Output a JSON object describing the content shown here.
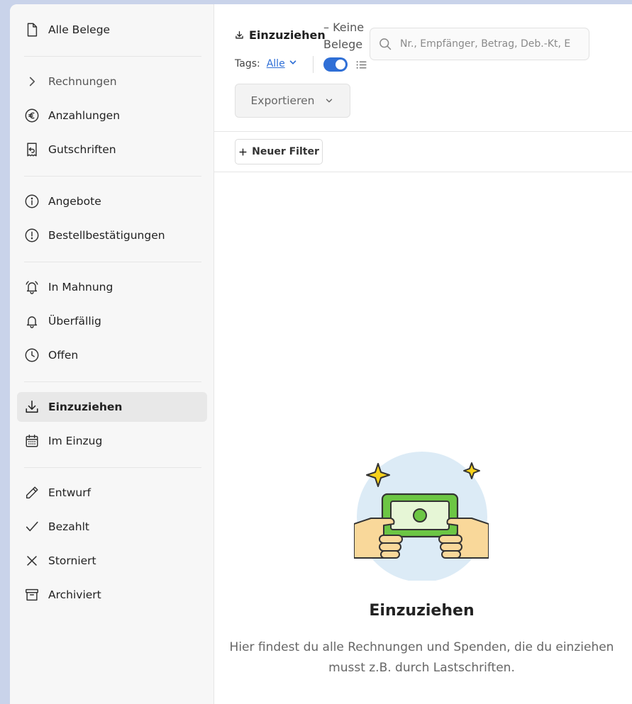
{
  "sidebar": {
    "items": [
      {
        "label": "Alle Belege",
        "icon": "document-icon"
      },
      {
        "label": "Rechnungen",
        "icon": "chevron-right-icon"
      },
      {
        "label": "Anzahlungen",
        "icon": "euro-icon"
      },
      {
        "label": "Gutschriften",
        "icon": "receipt-return-icon"
      },
      {
        "label": "Angebote",
        "icon": "info-icon"
      },
      {
        "label": "Bestellbestätigungen",
        "icon": "exclamation-icon"
      },
      {
        "label": "In Mahnung",
        "icon": "alarm-bell-icon"
      },
      {
        "label": "Überfällig",
        "icon": "bell-icon"
      },
      {
        "label": "Offen",
        "icon": "clock-icon"
      },
      {
        "label": "Einzuziehen",
        "icon": "download-icon",
        "active": true
      },
      {
        "label": "Im Einzug",
        "icon": "calendar-icon"
      },
      {
        "label": "Entwurf",
        "icon": "pencil-icon"
      },
      {
        "label": "Bezahlt",
        "icon": "check-icon"
      },
      {
        "label": "Storniert",
        "icon": "x-icon"
      },
      {
        "label": "Archiviert",
        "icon": "archive-icon"
      }
    ]
  },
  "toolbar": {
    "title": "Einzuziehen",
    "count": "– Keine Belege",
    "search_placeholder": "Nr., Empfänger, Betrag, Deb.-Kt, E",
    "tags_label": "Tags:",
    "tags_value": "Alle",
    "toggle_on": true,
    "export_label": "Exportieren",
    "new_filter_label": "Neuer Filter"
  },
  "empty_state": {
    "title": "Einzuziehen",
    "description": "Hier findest du alle Rechnungen und Spenden, die du einziehen musst z.B. durch Lastschriften."
  },
  "colors": {
    "accent": "#2f6fd6",
    "sidebar_bg": "#f7f7f7",
    "active_item_bg": "#e8e8e8",
    "money_green": "#6cc644",
    "sparkle_yellow": "#f7d21c",
    "illustration_circle": "#dcebf6"
  }
}
